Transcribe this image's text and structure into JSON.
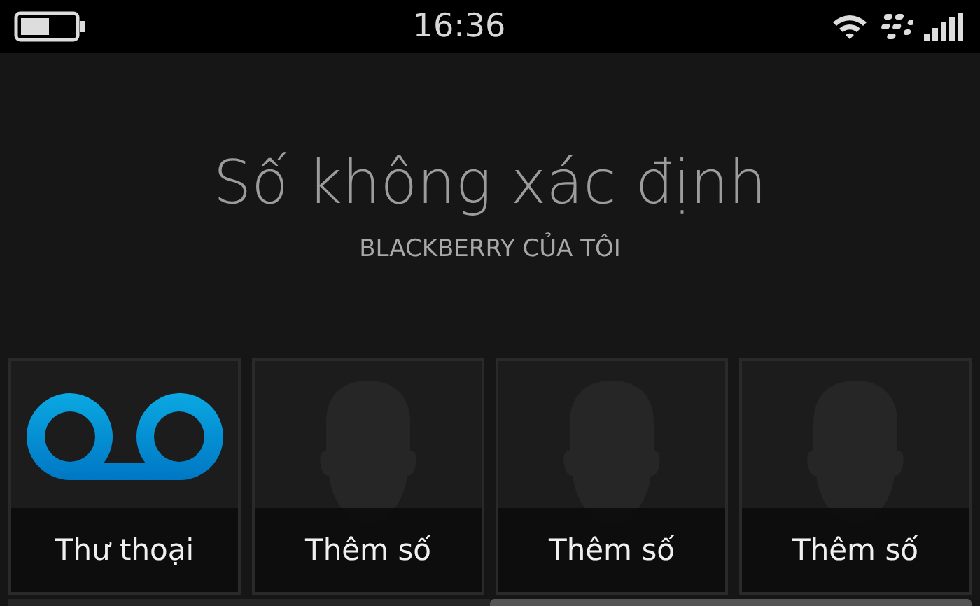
{
  "status_bar": {
    "time": "16:36"
  },
  "caller": {
    "name": "Số không xác định",
    "subtitle": "BLACKBERRY CỦA TÔI"
  },
  "speed_dial": [
    {
      "kind": "voicemail",
      "label": "Thư thoại"
    },
    {
      "kind": "contact",
      "label": "Thêm số"
    },
    {
      "kind": "contact",
      "label": "Thêm số"
    },
    {
      "kind": "contact",
      "label": "Thêm số"
    }
  ]
}
